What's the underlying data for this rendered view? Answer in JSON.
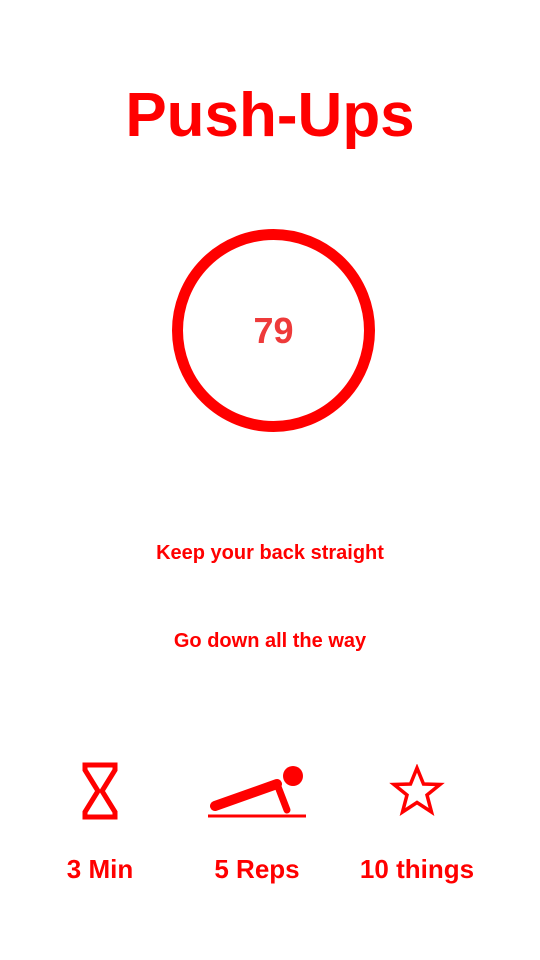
{
  "header": {
    "title": "Push-Ups"
  },
  "counter": {
    "value": "79"
  },
  "tips": [
    "Keep your back straight",
    "Go down all the way"
  ],
  "stats": [
    {
      "icon": "hourglass-icon",
      "label": "3 Min"
    },
    {
      "icon": "pushup-figure-icon",
      "label": "5 Reps"
    },
    {
      "icon": "star-icon",
      "label": "10 things"
    }
  ],
  "colors": {
    "accent": "#ff0000",
    "counter_text": "#ee3a3a",
    "background": "#ffffff"
  }
}
